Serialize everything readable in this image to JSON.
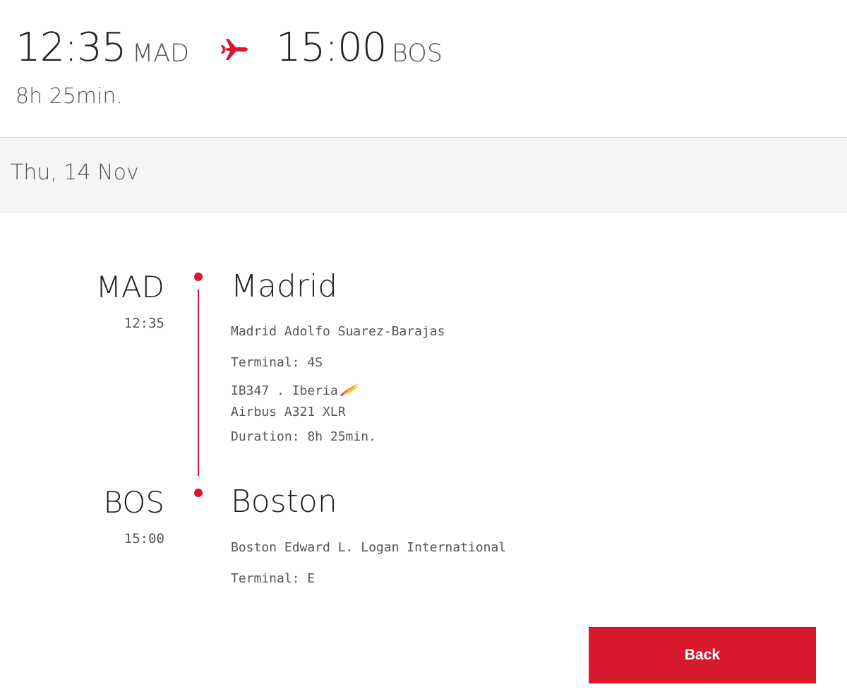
{
  "summary": {
    "departure_time": "12:35",
    "departure_code": "MAD",
    "arrival_time": "15:00",
    "arrival_code": "BOS",
    "duration": "8h 25min.",
    "plane_icon": "plane-icon"
  },
  "date": "Thu, 14 Nov",
  "segment": {
    "origin": {
      "code": "MAD",
      "time": "12:35",
      "city": "Madrid",
      "airport": "Madrid Adolfo Suarez-Barajas",
      "terminal": "Terminal: 4S",
      "flight": "IB347 . Iberia",
      "aircraft": "Airbus A321 XLR",
      "duration": "Duration: 8h 25min."
    },
    "destination": {
      "code": "BOS",
      "time": "15:00",
      "city": "Boston",
      "airport": "Boston Edward L. Logan International",
      "terminal": "Terminal: E"
    }
  },
  "actions": {
    "back_label": "Back"
  },
  "colors": {
    "accent": "#d7192d",
    "text_dark": "#222222",
    "text_muted": "#555555",
    "date_bar_bg": "#f5f5f5"
  }
}
